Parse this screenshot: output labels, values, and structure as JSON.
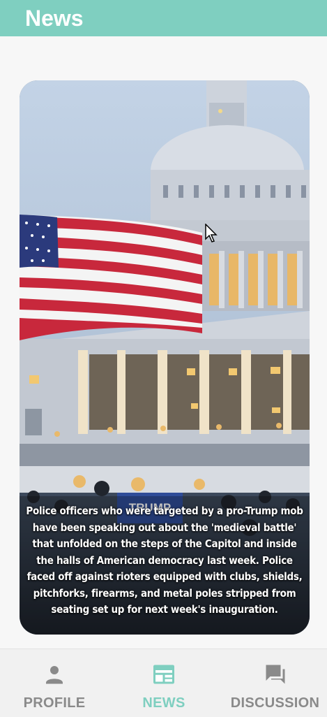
{
  "app_bar": {
    "title": "News"
  },
  "article": {
    "image_icon": "capitol-photo",
    "caption": "Police officers who were targeted by a pro-Trump mob have been speaking out about the 'medieval battle' that unfolded on the steps of the Capitol and inside the halls of American democracy last week. Police faced off against rioters equipped with clubs, shields, pitchforks, firearms, and metal poles stripped from seating set up for next week's inauguration.",
    "banner_text": "TRUMP"
  },
  "bottom_nav": {
    "active": "news",
    "items": [
      {
        "id": "profile",
        "label": "PROFILE",
        "icon": "person-icon"
      },
      {
        "id": "news",
        "label": "NEWS",
        "icon": "newspaper-icon"
      },
      {
        "id": "discussion",
        "label": "DISCUSSION",
        "icon": "forum-icon"
      }
    ]
  },
  "colors": {
    "primary": "#7fcfc0",
    "nav_active": "#7fcfc0",
    "nav_inactive": "#8a8a8a"
  }
}
